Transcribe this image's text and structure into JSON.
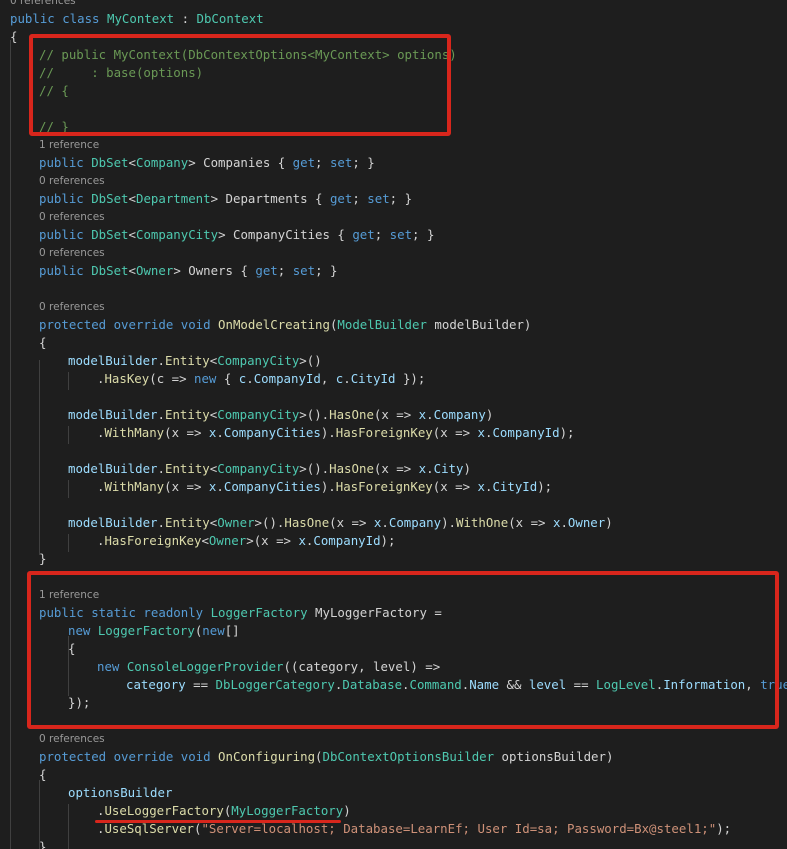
{
  "editor": {
    "lines": [
      {
        "kind": "lens",
        "text": "0 references",
        "indent": 0
      },
      {
        "kind": "code",
        "indent": 0,
        "tokens": [
          {
            "t": "public class ",
            "c": "kw"
          },
          {
            "t": "MyContext",
            "c": "ty"
          },
          {
            "t": " : ",
            "c": "pl"
          },
          {
            "t": "DbContext",
            "c": "ty"
          }
        ]
      },
      {
        "kind": "code",
        "indent": 0,
        "tokens": [
          {
            "t": "{",
            "c": "pl"
          }
        ]
      },
      {
        "kind": "code",
        "indent": 1,
        "tokens": [
          {
            "t": "// public MyContext(DbContextOptions<MyContext> options)",
            "c": "cm"
          }
        ]
      },
      {
        "kind": "code",
        "indent": 1,
        "tokens": [
          {
            "t": "//     : base(options)",
            "c": "cm"
          }
        ]
      },
      {
        "kind": "code",
        "indent": 1,
        "tokens": [
          {
            "t": "// {",
            "c": "cm"
          }
        ]
      },
      {
        "kind": "code",
        "indent": 1,
        "tokens": []
      },
      {
        "kind": "code",
        "indent": 1,
        "tokens": [
          {
            "t": "// }",
            "c": "cm"
          }
        ]
      },
      {
        "kind": "lens",
        "text": "1 reference",
        "indent": 1
      },
      {
        "kind": "code",
        "indent": 1,
        "tokens": [
          {
            "t": "public ",
            "c": "kw"
          },
          {
            "t": "DbSet",
            "c": "ty"
          },
          {
            "t": "<",
            "c": "pl"
          },
          {
            "t": "Company",
            "c": "ty"
          },
          {
            "t": "> Companies { ",
            "c": "pl"
          },
          {
            "t": "get",
            "c": "kw"
          },
          {
            "t": "; ",
            "c": "pl"
          },
          {
            "t": "set",
            "c": "kw"
          },
          {
            "t": "; }",
            "c": "pl"
          }
        ]
      },
      {
        "kind": "lens",
        "text": "0 references",
        "indent": 1
      },
      {
        "kind": "code",
        "indent": 1,
        "tokens": [
          {
            "t": "public ",
            "c": "kw"
          },
          {
            "t": "DbSet",
            "c": "ty"
          },
          {
            "t": "<",
            "c": "pl"
          },
          {
            "t": "Department",
            "c": "ty"
          },
          {
            "t": "> Departments { ",
            "c": "pl"
          },
          {
            "t": "get",
            "c": "kw"
          },
          {
            "t": "; ",
            "c": "pl"
          },
          {
            "t": "set",
            "c": "kw"
          },
          {
            "t": "; }",
            "c": "pl"
          }
        ]
      },
      {
        "kind": "lens",
        "text": "0 references",
        "indent": 1
      },
      {
        "kind": "code",
        "indent": 1,
        "tokens": [
          {
            "t": "public ",
            "c": "kw"
          },
          {
            "t": "DbSet",
            "c": "ty"
          },
          {
            "t": "<",
            "c": "pl"
          },
          {
            "t": "CompanyCity",
            "c": "ty"
          },
          {
            "t": "> CompanyCities { ",
            "c": "pl"
          },
          {
            "t": "get",
            "c": "kw"
          },
          {
            "t": "; ",
            "c": "pl"
          },
          {
            "t": "set",
            "c": "kw"
          },
          {
            "t": "; }",
            "c": "pl"
          }
        ]
      },
      {
        "kind": "lens",
        "text": "0 references",
        "indent": 1
      },
      {
        "kind": "code",
        "indent": 1,
        "tokens": [
          {
            "t": "public ",
            "c": "kw"
          },
          {
            "t": "DbSet",
            "c": "ty"
          },
          {
            "t": "<",
            "c": "pl"
          },
          {
            "t": "Owner",
            "c": "ty"
          },
          {
            "t": "> Owners { ",
            "c": "pl"
          },
          {
            "t": "get",
            "c": "kw"
          },
          {
            "t": "; ",
            "c": "pl"
          },
          {
            "t": "set",
            "c": "kw"
          },
          {
            "t": "; }",
            "c": "pl"
          }
        ]
      },
      {
        "kind": "code",
        "indent": 1,
        "tokens": []
      },
      {
        "kind": "lens",
        "text": "0 references",
        "indent": 1
      },
      {
        "kind": "code",
        "indent": 1,
        "tokens": [
          {
            "t": "protected override void ",
            "c": "kw"
          },
          {
            "t": "OnModelCreating",
            "c": "fn"
          },
          {
            "t": "(",
            "c": "pl"
          },
          {
            "t": "ModelBuilder",
            "c": "ty"
          },
          {
            "t": " modelBuilder)",
            "c": "pl"
          }
        ]
      },
      {
        "kind": "code",
        "indent": 1,
        "tokens": [
          {
            "t": "{",
            "c": "pl"
          }
        ]
      },
      {
        "kind": "code",
        "indent": 2,
        "tokens": [
          {
            "t": "modelBuilder",
            "c": "va"
          },
          {
            "t": ".",
            "c": "pl"
          },
          {
            "t": "Entity",
            "c": "fn"
          },
          {
            "t": "<",
            "c": "pl"
          },
          {
            "t": "CompanyCity",
            "c": "ty"
          },
          {
            "t": ">()",
            "c": "pl"
          }
        ]
      },
      {
        "kind": "code",
        "indent": 3,
        "tokens": [
          {
            "t": ".",
            "c": "pl"
          },
          {
            "t": "HasKey",
            "c": "fn"
          },
          {
            "t": "(c => ",
            "c": "pl"
          },
          {
            "t": "new",
            "c": "kw"
          },
          {
            "t": " { ",
            "c": "pl"
          },
          {
            "t": "c",
            "c": "va"
          },
          {
            "t": ".",
            "c": "pl"
          },
          {
            "t": "CompanyId",
            "c": "va"
          },
          {
            "t": ", ",
            "c": "pl"
          },
          {
            "t": "c",
            "c": "va"
          },
          {
            "t": ".",
            "c": "pl"
          },
          {
            "t": "CityId",
            "c": "va"
          },
          {
            "t": " });",
            "c": "pl"
          }
        ]
      },
      {
        "kind": "code",
        "indent": 2,
        "tokens": []
      },
      {
        "kind": "code",
        "indent": 2,
        "tokens": [
          {
            "t": "modelBuilder",
            "c": "va"
          },
          {
            "t": ".",
            "c": "pl"
          },
          {
            "t": "Entity",
            "c": "fn"
          },
          {
            "t": "<",
            "c": "pl"
          },
          {
            "t": "CompanyCity",
            "c": "ty"
          },
          {
            "t": ">().",
            "c": "pl"
          },
          {
            "t": "HasOne",
            "c": "fn"
          },
          {
            "t": "(x => ",
            "c": "pl"
          },
          {
            "t": "x",
            "c": "va"
          },
          {
            "t": ".",
            "c": "pl"
          },
          {
            "t": "Company",
            "c": "va"
          },
          {
            "t": ")",
            "c": "pl"
          }
        ]
      },
      {
        "kind": "code",
        "indent": 3,
        "tokens": [
          {
            "t": ".",
            "c": "pl"
          },
          {
            "t": "WithMany",
            "c": "fn"
          },
          {
            "t": "(x => ",
            "c": "pl"
          },
          {
            "t": "x",
            "c": "va"
          },
          {
            "t": ".",
            "c": "pl"
          },
          {
            "t": "CompanyCities",
            "c": "va"
          },
          {
            "t": ").",
            "c": "pl"
          },
          {
            "t": "HasForeignKey",
            "c": "fn"
          },
          {
            "t": "(x => ",
            "c": "pl"
          },
          {
            "t": "x",
            "c": "va"
          },
          {
            "t": ".",
            "c": "pl"
          },
          {
            "t": "CompanyId",
            "c": "va"
          },
          {
            "t": ");",
            "c": "pl"
          }
        ]
      },
      {
        "kind": "code",
        "indent": 2,
        "tokens": []
      },
      {
        "kind": "code",
        "indent": 2,
        "tokens": [
          {
            "t": "modelBuilder",
            "c": "va"
          },
          {
            "t": ".",
            "c": "pl"
          },
          {
            "t": "Entity",
            "c": "fn"
          },
          {
            "t": "<",
            "c": "pl"
          },
          {
            "t": "CompanyCity",
            "c": "ty"
          },
          {
            "t": ">().",
            "c": "pl"
          },
          {
            "t": "HasOne",
            "c": "fn"
          },
          {
            "t": "(x => ",
            "c": "pl"
          },
          {
            "t": "x",
            "c": "va"
          },
          {
            "t": ".",
            "c": "pl"
          },
          {
            "t": "City",
            "c": "va"
          },
          {
            "t": ")",
            "c": "pl"
          }
        ]
      },
      {
        "kind": "code",
        "indent": 3,
        "tokens": [
          {
            "t": ".",
            "c": "pl"
          },
          {
            "t": "WithMany",
            "c": "fn"
          },
          {
            "t": "(x => ",
            "c": "pl"
          },
          {
            "t": "x",
            "c": "va"
          },
          {
            "t": ".",
            "c": "pl"
          },
          {
            "t": "CompanyCities",
            "c": "va"
          },
          {
            "t": ").",
            "c": "pl"
          },
          {
            "t": "HasForeignKey",
            "c": "fn"
          },
          {
            "t": "(x => ",
            "c": "pl"
          },
          {
            "t": "x",
            "c": "va"
          },
          {
            "t": ".",
            "c": "pl"
          },
          {
            "t": "CityId",
            "c": "va"
          },
          {
            "t": ");",
            "c": "pl"
          }
        ]
      },
      {
        "kind": "code",
        "indent": 2,
        "tokens": []
      },
      {
        "kind": "code",
        "indent": 2,
        "tokens": [
          {
            "t": "modelBuilder",
            "c": "va"
          },
          {
            "t": ".",
            "c": "pl"
          },
          {
            "t": "Entity",
            "c": "fn"
          },
          {
            "t": "<",
            "c": "pl"
          },
          {
            "t": "Owner",
            "c": "ty"
          },
          {
            "t": ">().",
            "c": "pl"
          },
          {
            "t": "HasOne",
            "c": "fn"
          },
          {
            "t": "(x => ",
            "c": "pl"
          },
          {
            "t": "x",
            "c": "va"
          },
          {
            "t": ".",
            "c": "pl"
          },
          {
            "t": "Company",
            "c": "va"
          },
          {
            "t": ").",
            "c": "pl"
          },
          {
            "t": "WithOne",
            "c": "fn"
          },
          {
            "t": "(x => ",
            "c": "pl"
          },
          {
            "t": "x",
            "c": "va"
          },
          {
            "t": ".",
            "c": "pl"
          },
          {
            "t": "Owner",
            "c": "va"
          },
          {
            "t": ")",
            "c": "pl"
          }
        ]
      },
      {
        "kind": "code",
        "indent": 3,
        "tokens": [
          {
            "t": ".",
            "c": "pl"
          },
          {
            "t": "HasForeignKey",
            "c": "fn"
          },
          {
            "t": "<",
            "c": "pl"
          },
          {
            "t": "Owner",
            "c": "ty"
          },
          {
            "t": ">(x => ",
            "c": "pl"
          },
          {
            "t": "x",
            "c": "va"
          },
          {
            "t": ".",
            "c": "pl"
          },
          {
            "t": "CompanyId",
            "c": "va"
          },
          {
            "t": ");",
            "c": "pl"
          }
        ]
      },
      {
        "kind": "code",
        "indent": 1,
        "tokens": [
          {
            "t": "}",
            "c": "pl"
          }
        ]
      },
      {
        "kind": "code",
        "indent": 1,
        "tokens": []
      },
      {
        "kind": "lens",
        "text": "1 reference",
        "indent": 1
      },
      {
        "kind": "code",
        "indent": 1,
        "tokens": [
          {
            "t": "public static readonly ",
            "c": "kw"
          },
          {
            "t": "LoggerFactory",
            "c": "ty"
          },
          {
            "t": " MyLoggerFactory =",
            "c": "pl"
          }
        ]
      },
      {
        "kind": "code",
        "indent": 2,
        "tokens": [
          {
            "t": "new ",
            "c": "kw"
          },
          {
            "t": "LoggerFactory",
            "c": "ty"
          },
          {
            "t": "(",
            "c": "pl"
          },
          {
            "t": "new",
            "c": "kw"
          },
          {
            "t": "[]",
            "c": "pl"
          }
        ]
      },
      {
        "kind": "code",
        "indent": 2,
        "tokens": [
          {
            "t": "{",
            "c": "pl"
          }
        ]
      },
      {
        "kind": "code",
        "indent": 3,
        "tokens": [
          {
            "t": "new ",
            "c": "kw"
          },
          {
            "t": "ConsoleLoggerProvider",
            "c": "ty"
          },
          {
            "t": "((category, level) =>",
            "c": "pl"
          }
        ]
      },
      {
        "kind": "code",
        "indent": 4,
        "tokens": [
          {
            "t": "category",
            "c": "va"
          },
          {
            "t": " == ",
            "c": "pl"
          },
          {
            "t": "DbLoggerCategory",
            "c": "ty"
          },
          {
            "t": ".",
            "c": "pl"
          },
          {
            "t": "Database",
            "c": "ty"
          },
          {
            "t": ".",
            "c": "pl"
          },
          {
            "t": "Command",
            "c": "ty"
          },
          {
            "t": ".",
            "c": "pl"
          },
          {
            "t": "Name",
            "c": "va"
          },
          {
            "t": " && ",
            "c": "pl"
          },
          {
            "t": "level",
            "c": "va"
          },
          {
            "t": " == ",
            "c": "pl"
          },
          {
            "t": "LogLevel",
            "c": "ty"
          },
          {
            "t": ".",
            "c": "pl"
          },
          {
            "t": "Information",
            "c": "va"
          },
          {
            "t": ", ",
            "c": "pl"
          },
          {
            "t": "true",
            "c": "kw"
          },
          {
            "t": ")",
            "c": "pl"
          }
        ]
      },
      {
        "kind": "code",
        "indent": 2,
        "tokens": [
          {
            "t": "});",
            "c": "pl"
          }
        ]
      },
      {
        "kind": "code",
        "indent": 1,
        "tokens": []
      },
      {
        "kind": "lens",
        "text": "0 references",
        "indent": 1
      },
      {
        "kind": "code",
        "indent": 1,
        "tokens": [
          {
            "t": "protected override void ",
            "c": "kw"
          },
          {
            "t": "OnConfiguring",
            "c": "fn"
          },
          {
            "t": "(",
            "c": "pl"
          },
          {
            "t": "DbContextOptionsBuilder",
            "c": "ty"
          },
          {
            "t": " optionsBuilder)",
            "c": "pl"
          }
        ]
      },
      {
        "kind": "code",
        "indent": 1,
        "tokens": [
          {
            "t": "{",
            "c": "pl"
          }
        ]
      },
      {
        "kind": "code",
        "indent": 2,
        "tokens": [
          {
            "t": "optionsBuilder",
            "c": "va"
          }
        ]
      },
      {
        "kind": "code",
        "indent": 3,
        "tokens": [
          {
            "t": ".",
            "c": "pl"
          },
          {
            "t": "UseLoggerFactory",
            "c": "fn"
          },
          {
            "t": "(",
            "c": "pl"
          },
          {
            "t": "MyLoggerFactory",
            "c": "ty"
          },
          {
            "t": ")",
            "c": "pl"
          }
        ]
      },
      {
        "kind": "code",
        "indent": 3,
        "tokens": [
          {
            "t": ".",
            "c": "pl"
          },
          {
            "t": "UseSqlServer",
            "c": "fn"
          },
          {
            "t": "(",
            "c": "pl"
          },
          {
            "t": "\"Server=localhost; Database=LearnEf; User Id=sa; Password=Bx@steel1;\"",
            "c": "st"
          },
          {
            "t": ");",
            "c": "pl"
          }
        ]
      },
      {
        "kind": "code",
        "indent": 1,
        "tokens": [
          {
            "t": "}",
            "c": "pl"
          }
        ]
      }
    ]
  }
}
